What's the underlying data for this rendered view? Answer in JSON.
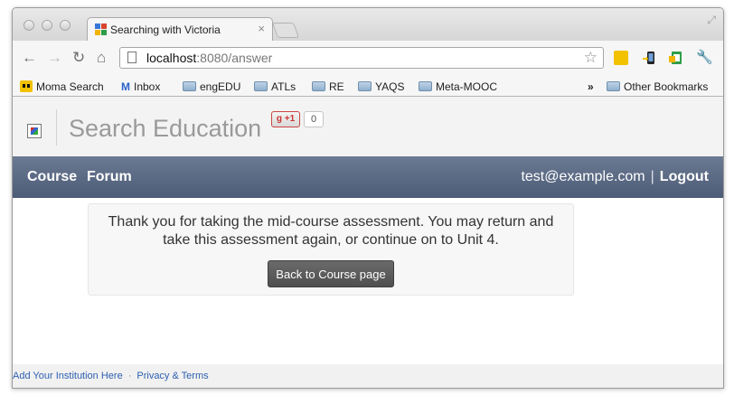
{
  "browser": {
    "tab": {
      "title": "Searching with Victoria",
      "close_glyph": "×"
    },
    "url": {
      "host": "localhost",
      "rest": ":8080/answer"
    },
    "nav": {
      "back_glyph": "←",
      "forward_glyph": "→",
      "reload_glyph": "↻",
      "home_glyph": "⌂",
      "star_glyph": "☆",
      "resize_glyph": "⤢",
      "wrench_glyph": "🔧"
    },
    "bookmarks": [
      {
        "label": "Moma Search",
        "icon": "badge-icon"
      },
      {
        "label": "Inbox",
        "icon": "gmail-icon",
        "icon_glyph": "M"
      },
      {
        "label": "engEDU",
        "icon": "folder-icon"
      },
      {
        "label": "ATLs",
        "icon": "folder-icon"
      },
      {
        "label": "RE",
        "icon": "folder-icon"
      },
      {
        "label": "YAQS",
        "icon": "folder-icon"
      },
      {
        "label": "Meta-MOOC",
        "icon": "folder-icon"
      }
    ],
    "overflow_glyph": "»",
    "other_bookmarks": "Other Bookmarks"
  },
  "site": {
    "title": "Search Education",
    "plusone": {
      "label": "+1",
      "count": "0"
    }
  },
  "navbar": {
    "links": [
      "Course",
      "Forum"
    ],
    "user_email": "test@example.com",
    "separator": "|",
    "logout": "Logout"
  },
  "main": {
    "message": "Thank you for taking the mid-course assessment. You may return and take this assessment again, or continue on to Unit 4.",
    "button": "Back to Course page"
  },
  "footer": {
    "links": [
      "Add Your Institution Here",
      "Privacy & Terms"
    ],
    "separator": "·"
  },
  "colors": {
    "navbar": "#5b6a84",
    "button": "#5a5a5a",
    "footer_link": "#2d5fb0"
  }
}
